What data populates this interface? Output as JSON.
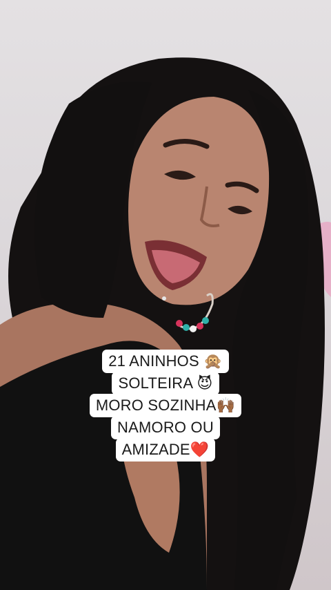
{
  "caption": {
    "lines": [
      "21 ANINHOS 🙊",
      "SOLTEIRA 😈",
      "MORO SOZINHA🙌🏾",
      "NAMORO OU",
      "AMIZADE❤️"
    ]
  },
  "photo": {
    "subject": "selfie-portrait",
    "colors": {
      "background": "#dcd8db",
      "hair": "#121010",
      "skin": "#b07a62",
      "top": "#111111",
      "pink-accent": "#e7a9c4"
    }
  }
}
